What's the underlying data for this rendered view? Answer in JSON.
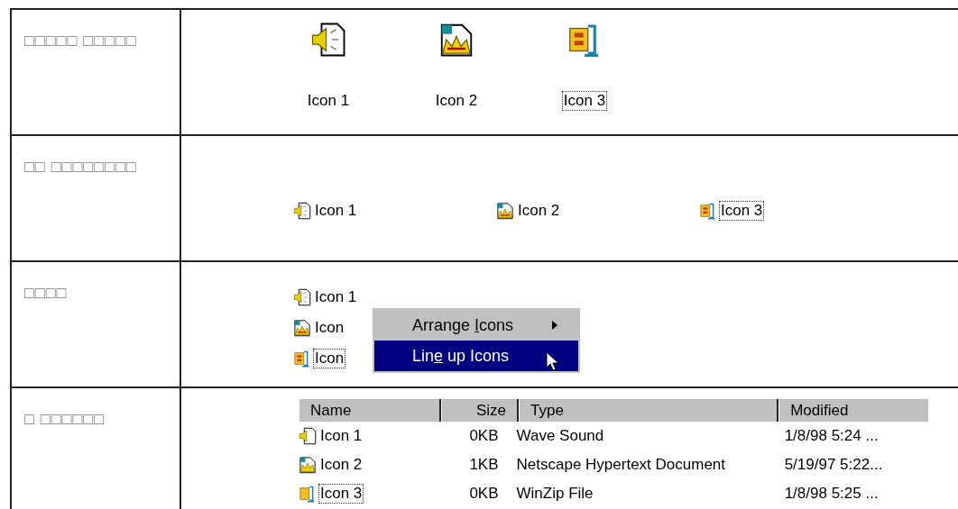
{
  "rows": [
    {
      "caption": "□□□□□ □□□□□",
      "view": {
        "kind": "large",
        "items": [
          {
            "label": "Icon 1",
            "kind": "sound",
            "focused": false
          },
          {
            "label": "Icon 2",
            "kind": "html",
            "focused": false
          },
          {
            "label": "Icon 3",
            "kind": "zip",
            "focused": true
          }
        ]
      }
    },
    {
      "caption": "□□ □□□□□□□□",
      "view": {
        "kind": "small",
        "items": [
          {
            "label": "Icon 1",
            "kind": "sound",
            "focused": false
          },
          {
            "label": "Icon 2",
            "kind": "html",
            "focused": false
          },
          {
            "label": "Icon 3",
            "kind": "zip",
            "focused": true
          }
        ]
      }
    },
    {
      "caption": "□□□□",
      "view": {
        "kind": "list",
        "items": [
          {
            "label": "Icon 1",
            "kind": "sound",
            "focused": false
          },
          {
            "label": "Icon",
            "kind": "html",
            "focused": false
          },
          {
            "label": "Icon",
            "kind": "zip",
            "focused": true
          }
        ],
        "context_menu": [
          {
            "label_start": "Arrange ",
            "access_key": "I",
            "label_end": "cons",
            "submenu": true,
            "selected": false
          },
          {
            "label_start": "Lin",
            "access_key": "e",
            "label_end": " up Icons",
            "submenu": false,
            "selected": true
          }
        ]
      }
    },
    {
      "caption": "□ □□□□□□",
      "view": {
        "kind": "details",
        "columns": [
          {
            "label": "Name"
          },
          {
            "label": "Size"
          },
          {
            "label": "Type"
          },
          {
            "label": "Modified"
          }
        ],
        "items": [
          {
            "label": "Icon 1",
            "kind": "sound",
            "focused": false,
            "size": "0KB",
            "type": "Wave Sound",
            "modified": "1/8/98 5:24 ..."
          },
          {
            "label": "Icon 2",
            "kind": "html",
            "focused": false,
            "size": "1KB",
            "type": "Netscape Hypertext Document",
            "modified": "5/19/97 5:22..."
          },
          {
            "label": "Icon 3",
            "kind": "zip",
            "focused": true,
            "size": "0KB",
            "type": "WinZip File",
            "modified": "1/8/98 5:25 ..."
          }
        ]
      }
    }
  ]
}
